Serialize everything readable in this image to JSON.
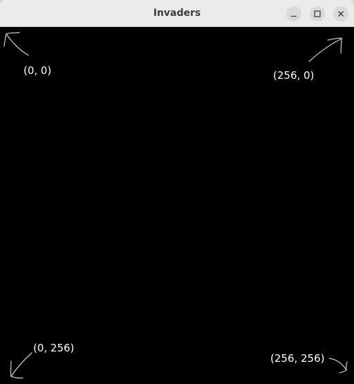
{
  "window": {
    "title": "Invaders",
    "controls": {
      "minimize_icon": "minimize-icon",
      "maximize_icon": "maximize-icon",
      "close_icon": "close-icon"
    }
  },
  "canvas": {
    "background": "#000000",
    "annotations": {
      "top_left": "(0, 0)",
      "top_right": "(256, 0)",
      "bottom_left": "(0, 256)",
      "bottom_right": "(256, 256)"
    },
    "stroke_color": "#cfcfcf",
    "text_color": "#ffffff"
  }
}
